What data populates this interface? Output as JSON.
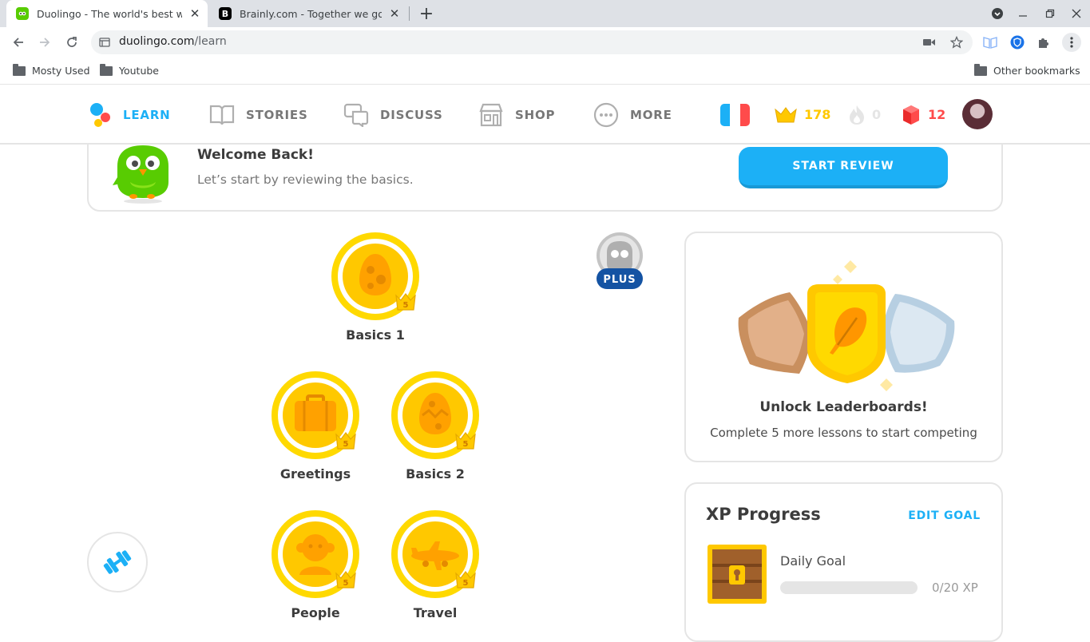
{
  "browser": {
    "tabs": [
      {
        "title": "Duolingo - The world's best way t",
        "favicon": "duolingo-favicon",
        "active": true
      },
      {
        "title": "Brainly.com - Together we go far",
        "favicon": "brainly-favicon",
        "active": false
      }
    ],
    "url_domain": "duolingo.com",
    "url_path": "/learn",
    "bookmarks": [
      {
        "label": "Mosty Used",
        "icon": "folder-icon"
      },
      {
        "label": "Youtube",
        "icon": "folder-icon"
      }
    ],
    "other_bookmarks": "Other bookmarks"
  },
  "nav": {
    "items": [
      {
        "label": "LEARN",
        "icon": "learn-icon",
        "active": true
      },
      {
        "label": "STORIES",
        "icon": "stories-icon",
        "active": false
      },
      {
        "label": "DISCUSS",
        "icon": "discuss-icon",
        "active": false
      },
      {
        "label": "SHOP",
        "icon": "shop-icon",
        "active": false
      },
      {
        "label": "MORE",
        "icon": "more-icon",
        "active": false
      }
    ],
    "language_flag": "french-flag-icon",
    "crowns": "178",
    "streak": "0",
    "gems": "12"
  },
  "welcome": {
    "title": "Welcome Back!",
    "subtitle": "Let’s start by reviewing the basics.",
    "button": "START REVIEW"
  },
  "skills": [
    {
      "label": "Basics 1",
      "icon": "egg-icon",
      "crown_level": "5"
    },
    {
      "label": "Greetings",
      "icon": "suitcase-icon",
      "crown_level": "5"
    },
    {
      "label": "Basics 2",
      "icon": "egg-icon",
      "crown_level": "5"
    },
    {
      "label": "People",
      "icon": "person-icon",
      "crown_level": "5"
    },
    {
      "label": "Travel",
      "icon": "airplane-icon",
      "crown_level": "5"
    }
  ],
  "plus_badge": "PLUS",
  "leaderboard": {
    "title": "Unlock Leaderboards!",
    "subtitle": "Complete 5 more lessons to start competing"
  },
  "xp_progress": {
    "title": "XP Progress",
    "edit_goal": "EDIT GOAL",
    "daily_goal_label": "Daily Goal",
    "progress_text": "0/20 XP",
    "progress_fraction": 0
  },
  "colors": {
    "accent_blue": "#1cb0f6",
    "gold": "#ffc800",
    "gem_red": "#ff4b4b",
    "owl_green": "#58cc02"
  }
}
